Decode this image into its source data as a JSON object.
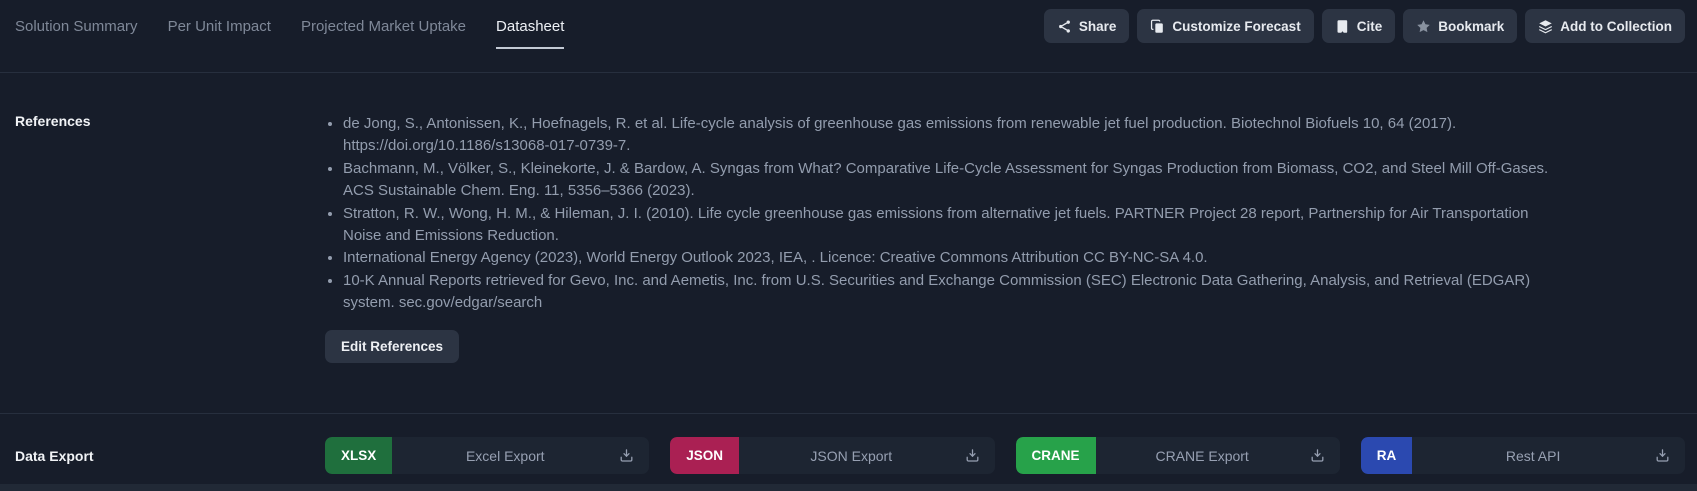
{
  "colors": {
    "page_bg": "#171d2a",
    "panel_button_bg": "#2c3443",
    "divider": "#272f3e",
    "reference_text": "#939dae",
    "active_tab_underline": "#c3c9d4"
  },
  "tabs": [
    {
      "label": "Solution Summary",
      "active": false
    },
    {
      "label": "Per Unit Impact",
      "active": false
    },
    {
      "label": "Projected Market Uptake",
      "active": false
    },
    {
      "label": "Datasheet",
      "active": true
    }
  ],
  "actions": [
    {
      "label": "Share",
      "icon": "share-icon"
    },
    {
      "label": "Customize Forecast",
      "icon": "copy-icon"
    },
    {
      "label": "Cite",
      "icon": "book-icon"
    },
    {
      "label": "Bookmark",
      "icon": "star-icon"
    },
    {
      "label": "Add to Collection",
      "icon": "layers-icon"
    }
  ],
  "references": {
    "label": "References",
    "items": [
      "de Jong, S., Antonissen, K., Hoefnagels, R. et al. Life-cycle analysis of greenhouse gas emissions from renewable jet fuel production. Biotechnol Biofuels 10, 64 (2017). https://doi.org/10.1186/s13068-017-0739-7.",
      "Bachmann, M., Völker, S., Kleinekorte, J. & Bardow, A. Syngas from What? Comparative Life-Cycle Assessment for Syngas Production from Biomass, CO2, and Steel Mill Off-Gases. ACS Sustainable Chem. Eng. 11, 5356–5366 (2023).",
      "Stratton, R. W., Wong, H. M., & Hileman, J. I. (2010). Life cycle greenhouse gas emissions from alternative jet fuels. PARTNER Project 28 report, Partnership for Air Transportation Noise and Emissions Reduction.",
      "International Energy Agency (2023), World Energy Outlook 2023, IEA, . Licence: Creative Commons Attribution CC BY-NC-SA 4.0.",
      "10-K Annual Reports retrieved for Gevo, Inc. and Aemetis, Inc. from U.S. Securities and Exchange Commission (SEC) Electronic Data Gathering, Analysis, and Retrieval (EDGAR) system. sec.gov/edgar/search"
    ],
    "edit_button_label": "Edit References"
  },
  "data_export": {
    "label": "Data Export",
    "buttons": [
      {
        "badge": "XLSX",
        "badge_color": "#1f6f3d",
        "label": "Excel Export",
        "icon": "download-icon"
      },
      {
        "badge": "JSON",
        "badge_color": "#aa2053",
        "label": "JSON Export",
        "icon": "download-icon"
      },
      {
        "badge": "CRANE",
        "badge_color": "#27a24a",
        "label": "CRANE Export",
        "icon": "download-icon"
      },
      {
        "badge": "RA",
        "badge_color": "#2b49b0",
        "label": "Rest API",
        "icon": "download-icon"
      }
    ]
  }
}
